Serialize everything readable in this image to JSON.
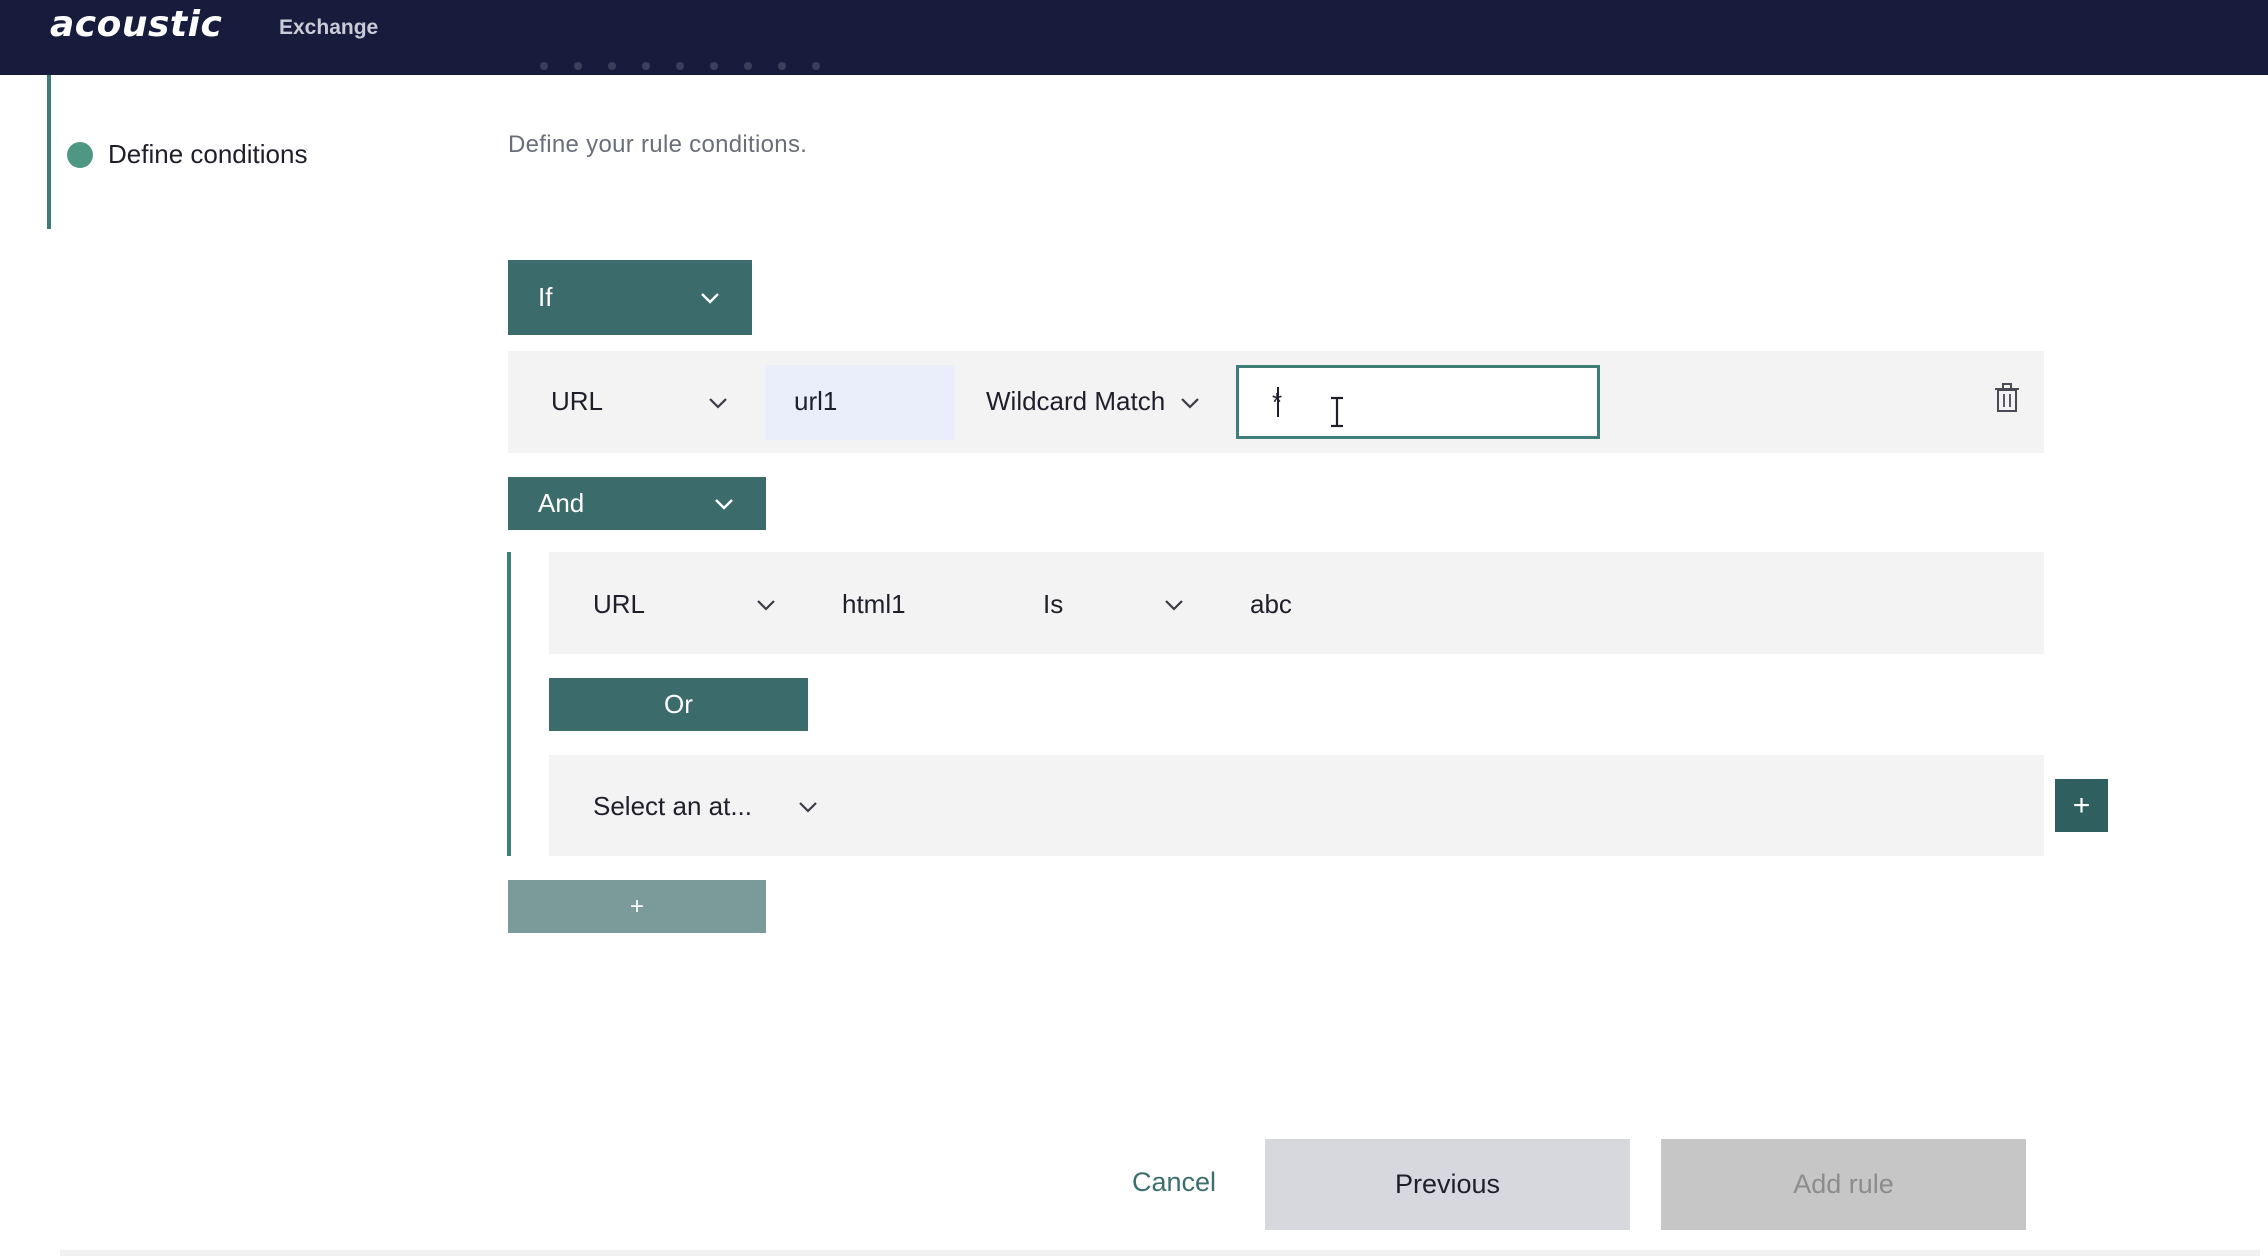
{
  "header": {
    "logo": "acoustic",
    "app_name": "Exchange"
  },
  "stepper": {
    "active_step": "Define conditions"
  },
  "main": {
    "subtitle": "Define your rule conditions.",
    "if_dropdown": "If",
    "condition1": {
      "attribute": "URL",
      "name": "url1",
      "operator": "Wildcard Match",
      "value": "*"
    },
    "and_dropdown": "And",
    "condition2": {
      "attribute": "URL",
      "name": "html1",
      "operator": "Is",
      "value": "abc"
    },
    "or_button": "Or",
    "condition3": {
      "attribute_placeholder": "Select an at..."
    },
    "add_condition_side": "+",
    "add_group": "+"
  },
  "footer": {
    "cancel": "Cancel",
    "previous": "Previous",
    "add_rule": "Add rule"
  },
  "colors": {
    "topbar": "#171c3d",
    "teal_dark": "#3c6b6c",
    "teal_accent": "#3f7d79",
    "step_dot": "#4f9684",
    "row_bg": "#f3f3f3"
  },
  "icons": {
    "chevron": "chevron-down-icon",
    "trash": "trash-icon",
    "plus": "plus-icon",
    "cursor": "text-cursor-icon"
  }
}
